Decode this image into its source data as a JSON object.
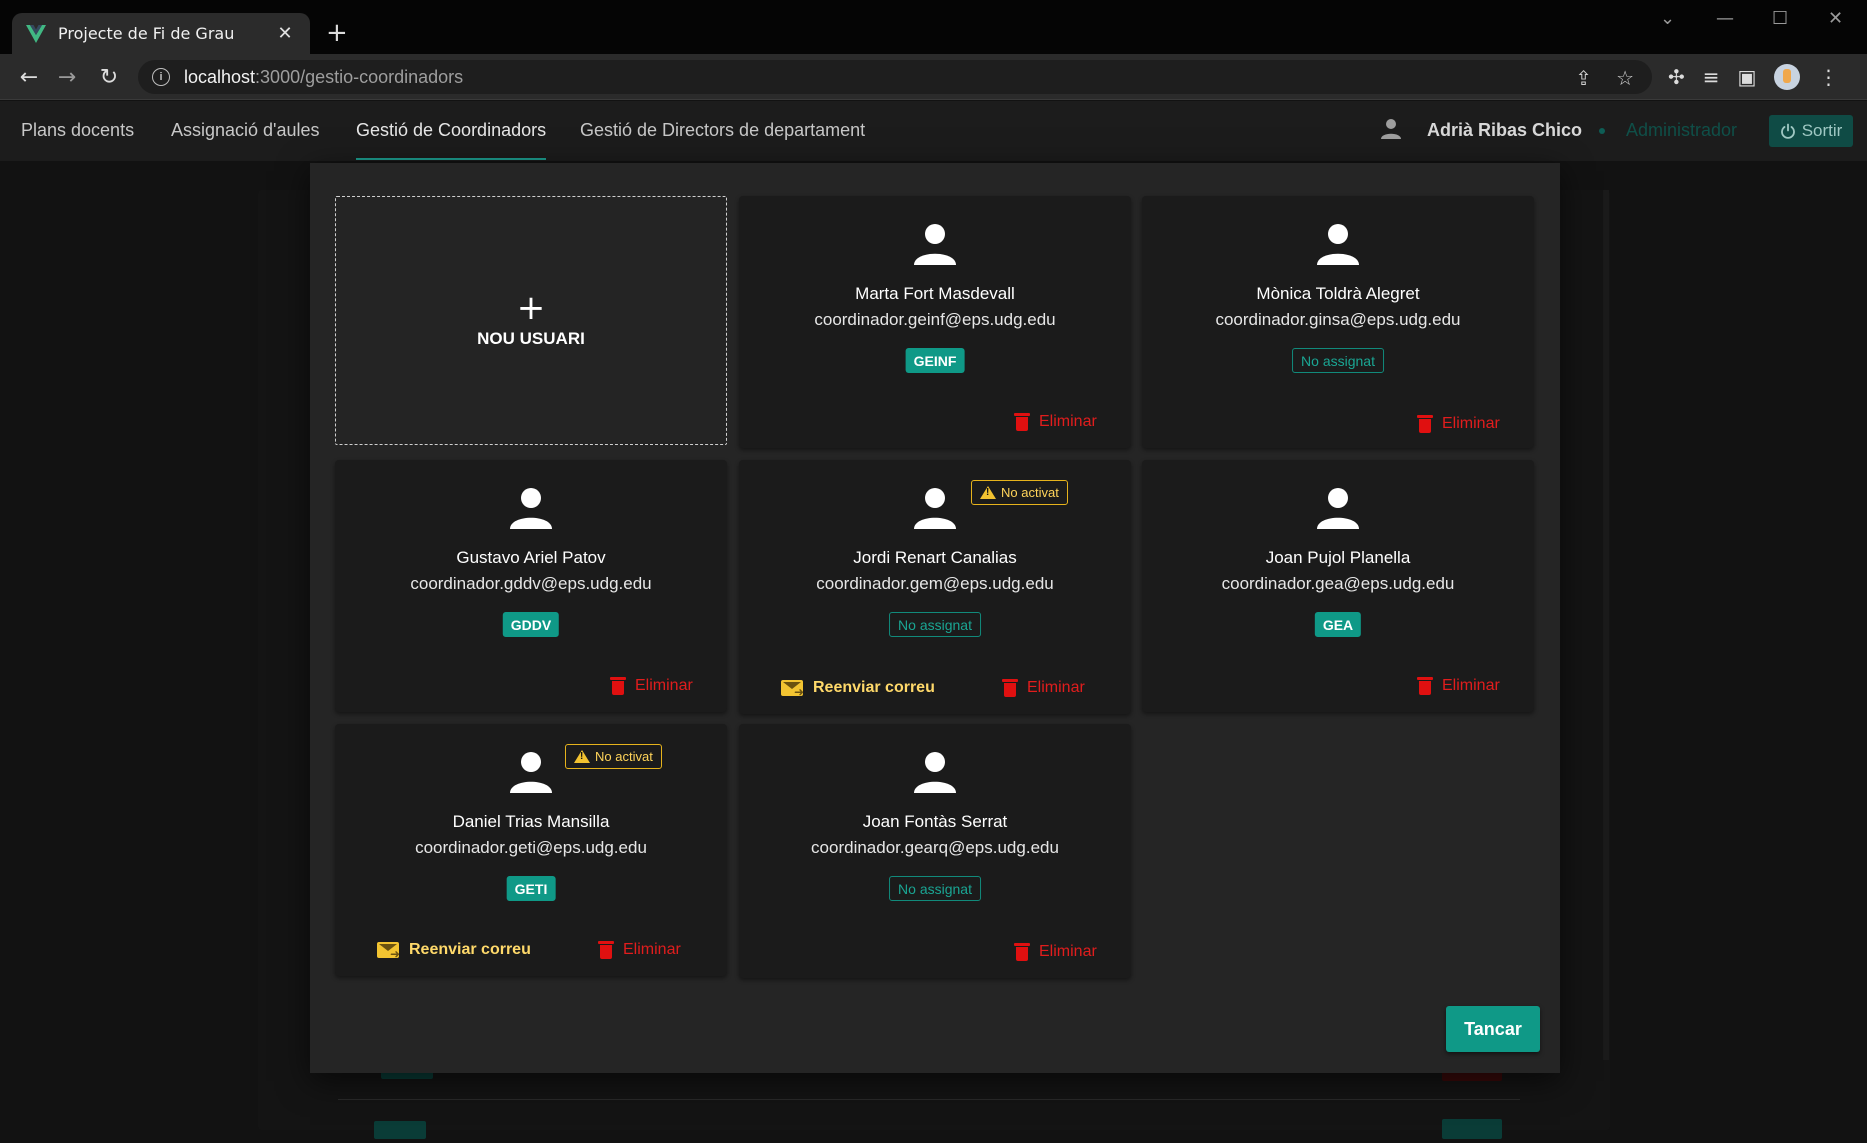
{
  "browser": {
    "tab_title": "Projecte de Fi de Grau",
    "tab_close": "✕",
    "new_tab": "+",
    "url_host": "localhost",
    "url_path": ":3000/gestio-coordinadors"
  },
  "nav": {
    "links": [
      "Plans docents",
      "Assignació d'aules",
      "Gestió de Coordinadors",
      "Gestió de Directors de departament"
    ],
    "active_index": 2,
    "user_name": "Adrià Ribas Chico",
    "role": "Administrador",
    "logout_label": "Sortir"
  },
  "dialog": {
    "new_user_label": "NOU USUARI",
    "close_label": "Tancar",
    "delete_label": "Eliminar",
    "resend_label": "Reenviar correu",
    "not_active_label": "No activat",
    "cards": [
      {
        "name": "Marta Fort Masdevall",
        "email": "coordinador.geinf@eps.udg.edu",
        "badge": "GEINF",
        "assigned": true,
        "activated": true
      },
      {
        "name": "Mònica Toldrà Alegret",
        "email": "coordinador.ginsa@eps.udg.edu",
        "badge": "No assignat",
        "assigned": false,
        "activated": true
      },
      {
        "name": "Gustavo Ariel Patov",
        "email": "coordinador.gddv@eps.udg.edu",
        "badge": "GDDV",
        "assigned": true,
        "activated": true
      },
      {
        "name": "Jordi Renart Canalias",
        "email": "coordinador.gem@eps.udg.edu",
        "badge": "No assignat",
        "assigned": false,
        "activated": false
      },
      {
        "name": "Joan Pujol Planella",
        "email": "coordinador.gea@eps.udg.edu",
        "badge": "GEA",
        "assigned": true,
        "activated": true
      },
      {
        "name": "Daniel Trias Mansilla",
        "email": "coordinador.geti@eps.udg.edu",
        "badge": "GETI",
        "assigned": true,
        "activated": false
      },
      {
        "name": "Joan Fontàs Serrat",
        "email": "coordinador.gearq@eps.udg.edu",
        "badge": "No assignat",
        "assigned": false,
        "activated": true
      }
    ]
  },
  "colors": {
    "accent": "#0f9987",
    "danger": "#e11d1d",
    "warning": "#f3c431"
  }
}
